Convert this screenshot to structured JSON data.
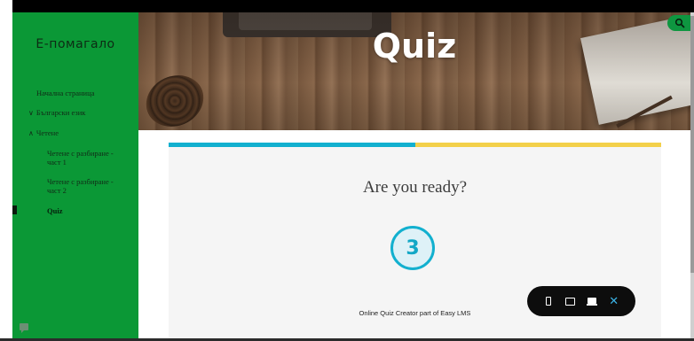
{
  "sidebar": {
    "brand": "Е-помагало",
    "items": [
      {
        "label": "Начална страница",
        "chevron": ""
      },
      {
        "label": "Български език",
        "chevron": "∨"
      },
      {
        "label": "Четене",
        "chevron": "∧"
      },
      {
        "label": "Четене с разбиране - част 1",
        "chevron": ""
      },
      {
        "label": "Четене с разбиране - част 2",
        "chevron": ""
      },
      {
        "label": "Quiz",
        "chevron": "",
        "active": true
      }
    ]
  },
  "hero": {
    "title": "Quiz"
  },
  "header": {
    "search_icon": "search-icon"
  },
  "quiz": {
    "title": "Are you ready?",
    "countdown": "3",
    "credit": "Online Quiz Creator part of Easy LMS",
    "progress_left_color": "#12b0cf",
    "progress_right_color": "#f3d04a"
  },
  "device_bar": {
    "buttons": [
      "phone-icon",
      "tablet-icon",
      "laptop-icon",
      "close-icon"
    ],
    "close_label": "✕"
  },
  "colors": {
    "sidebar": "#0b9836",
    "accent": "#12b0cf"
  }
}
